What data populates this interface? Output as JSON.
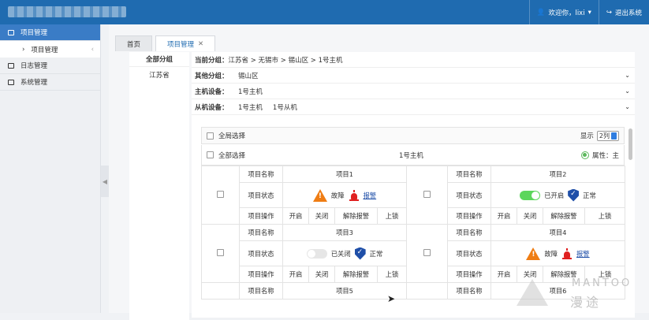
{
  "header": {
    "welcome": "欢迎你，lixi",
    "logout": "退出系统"
  },
  "sidebar": {
    "items": [
      {
        "label": "项目管理"
      },
      {
        "label": "项目管理"
      },
      {
        "label": "日志管理"
      },
      {
        "label": "系统管理"
      }
    ]
  },
  "tabs": [
    {
      "label": "首页"
    },
    {
      "label": "项目管理"
    }
  ],
  "groups": {
    "all": "全部分组",
    "items": [
      "江苏省"
    ]
  },
  "info": {
    "current_label": "当前分组：",
    "current_value": "江苏省 > 无锡市 > 锡山区 > 1号主机",
    "other_label": "其他分组：",
    "other_value": "锡山区",
    "host_label": "主机设备：",
    "host_value": "1号主机",
    "slave_label": "从机设备：",
    "slave_value1": "1号主机",
    "slave_value2": "1号从机"
  },
  "toolbar": {
    "select_all": "全局选择",
    "display_label": "显示",
    "display_value": "2列",
    "select_all_group": "全部选择",
    "host_name": "1号主机",
    "attr_label": "属性：主"
  },
  "labels": {
    "name": "项目名称",
    "status": "项目状态",
    "ops": "项目操作",
    "fault": "故障",
    "alarm": "报警",
    "on": "已开启",
    "off": "已关闭",
    "normal": "正常",
    "op_open": "开启",
    "op_close": "关闭",
    "op_release": "解除报警",
    "op_lock": "上锁"
  },
  "projects": [
    {
      "name": "项目1",
      "state": "fault"
    },
    {
      "name": "项目2",
      "state": "on"
    },
    {
      "name": "项目3",
      "state": "off"
    },
    {
      "name": "项目4",
      "state": "fault"
    },
    {
      "name": "项目5"
    },
    {
      "name": "项目6"
    }
  ],
  "watermark": {
    "latin": "MANTOO",
    "chinese": "漫途"
  },
  "colors": {
    "header": "#1f6bb0",
    "warning": "#ef7d14",
    "alarm": "#e02020",
    "toggle_on": "#5cd65c",
    "shield": "#1f4fa8"
  }
}
